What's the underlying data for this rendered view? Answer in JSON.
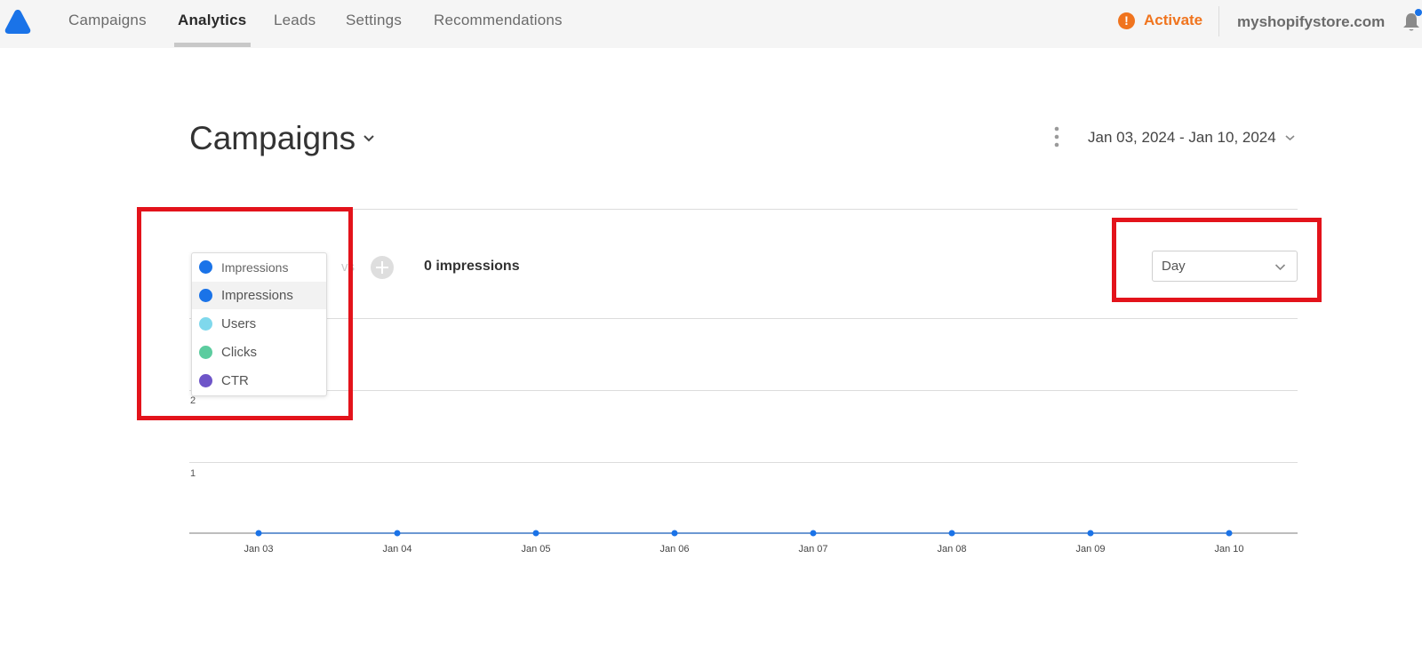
{
  "nav": {
    "items": [
      {
        "label": "Campaigns",
        "active": false
      },
      {
        "label": "Analytics",
        "active": true
      },
      {
        "label": "Leads",
        "active": false
      },
      {
        "label": "Settings",
        "active": false
      },
      {
        "label": "Recommendations",
        "active": false
      }
    ],
    "activate_label": "Activate",
    "activate_icon": "!",
    "store_name": "myshopifystore.com",
    "brand_color": "#1a73e8",
    "activate_color": "#f0741e"
  },
  "page": {
    "title": "Campaigns",
    "date_range": "Jan 03, 2024 - Jan 10, 2024"
  },
  "metrics": {
    "selected": "Impressions",
    "options": [
      {
        "label": "Impressions",
        "color": "#1a73e8"
      },
      {
        "label": "Users",
        "color": "#7fd8ec"
      },
      {
        "label": "Clicks",
        "color": "#5ccc9f"
      },
      {
        "label": "CTR",
        "color": "#6e55c8"
      }
    ],
    "vs_label": "vs",
    "summary": "0 impressions"
  },
  "granularity": {
    "value": "Day"
  },
  "chart_data": {
    "type": "line",
    "x": [
      "Jan 03",
      "Jan 04",
      "Jan 05",
      "Jan 06",
      "Jan 07",
      "Jan 08",
      "Jan 09",
      "Jan 10"
    ],
    "series": [
      {
        "name": "Impressions",
        "values": [
          0,
          0,
          0,
          0,
          0,
          0,
          0,
          0
        ],
        "color": "#1a73e8"
      }
    ],
    "y_ticks": [
      "1",
      "2"
    ],
    "ylim": [
      0,
      3
    ],
    "grid": true
  }
}
